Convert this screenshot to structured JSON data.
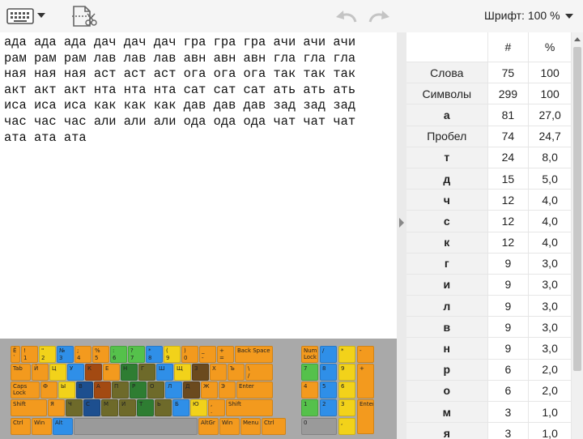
{
  "toolbar": {
    "font_label": "Шрифт: 100 %",
    "icons": [
      "keyboard-icon",
      "chevron-down-icon",
      "cut-file-icon",
      "undo-icon",
      "redo-icon"
    ]
  },
  "editor": {
    "lines": [
      "ада ада ада дач дач дач гра гра гра ачи ачи ачи",
      "рам рам рам лав лав лав авн авн авн гла гла гла",
      "ная ная ная аст аст аст ога ога ога так так так",
      "акт акт акт нта нта нта сат сат сат ать ать ать",
      "иса иса иса как как как дав дав дав зад зад зад",
      "час час час али али али ода ода ода чат чат чат",
      "ата ата ата"
    ]
  },
  "keyboard": {
    "rows": [
      [
        {
          "t": "Ё",
          "b": "`",
          "c": "orange"
        },
        {
          "t": "!",
          "b": "1",
          "c": "orange"
        },
        {
          "t": "\"",
          "b": "2",
          "c": "yellow"
        },
        {
          "t": "№",
          "b": "3",
          "c": "blue"
        },
        {
          "t": ";",
          "b": "4",
          "c": "orange"
        },
        {
          "t": "%",
          "b": "5",
          "c": "orange"
        },
        {
          "t": ":",
          "b": "6",
          "c": "green"
        },
        {
          "t": "?",
          "b": "7",
          "c": "green"
        },
        {
          "t": "*",
          "b": "8",
          "c": "blue"
        },
        {
          "t": "(",
          "b": "9",
          "c": "yellow"
        },
        {
          "t": ")",
          "b": "0",
          "c": "orange"
        },
        {
          "t": "_",
          "b": "-",
          "c": "orange"
        },
        {
          "t": "+",
          "b": "=",
          "c": "orange"
        },
        {
          "t": "Back Space",
          "b": "",
          "c": "orange"
        }
      ],
      [
        {
          "t": "Tab",
          "b": "",
          "c": "orange"
        },
        {
          "t": "Й",
          "b": "",
          "c": "orange"
        },
        {
          "t": "Ц",
          "b": "",
          "c": "yellow"
        },
        {
          "t": "У",
          "b": "",
          "c": "blue"
        },
        {
          "t": "К",
          "b": "",
          "c": "rust"
        },
        {
          "t": "Е",
          "b": "",
          "c": "orange"
        },
        {
          "t": "Н",
          "b": "",
          "c": "darkgreen"
        },
        {
          "t": "Г",
          "b": "",
          "c": "olive"
        },
        {
          "t": "Ш",
          "b": "",
          "c": "blue"
        },
        {
          "t": "Щ",
          "b": "",
          "c": "yellow"
        },
        {
          "t": "З",
          "b": "",
          "c": "brown"
        },
        {
          "t": "Х",
          "b": "",
          "c": "orange"
        },
        {
          "t": "Ъ",
          "b": "",
          "c": "orange"
        },
        {
          "t": "\\",
          "b": "/",
          "c": "orange"
        }
      ],
      [
        {
          "t": "Caps Lock",
          "b": "",
          "c": "orange"
        },
        {
          "t": "Ф",
          "b": "",
          "c": "orange"
        },
        {
          "t": "Ы",
          "b": "",
          "c": "yellow"
        },
        {
          "t": "В",
          "b": "",
          "c": "navy"
        },
        {
          "t": "А",
          "b": "",
          "c": "rust"
        },
        {
          "t": "П",
          "b": "",
          "c": "olive"
        },
        {
          "t": "Р",
          "b": "",
          "c": "darkgreen"
        },
        {
          "t": "О",
          "b": "",
          "c": "olive"
        },
        {
          "t": "Л",
          "b": "",
          "c": "blue"
        },
        {
          "t": "Д",
          "b": "",
          "c": "brown"
        },
        {
          "t": "Ж",
          "b": "",
          "c": "orange"
        },
        {
          "t": "Э",
          "b": "",
          "c": "orange"
        },
        {
          "t": "Enter",
          "b": "",
          "c": "orange"
        }
      ],
      [
        {
          "t": "Shift",
          "b": "",
          "c": "orange"
        },
        {
          "t": "Я",
          "b": "",
          "c": "orange"
        },
        {
          "t": "Ч",
          "b": "",
          "c": "olive"
        },
        {
          "t": "С",
          "b": "",
          "c": "navy"
        },
        {
          "t": "М",
          "b": "",
          "c": "olive"
        },
        {
          "t": "И",
          "b": "",
          "c": "olive"
        },
        {
          "t": "Т",
          "b": "",
          "c": "darkgreen"
        },
        {
          "t": "Ь",
          "b": "",
          "c": "olive"
        },
        {
          "t": "Б",
          "b": "",
          "c": "blue"
        },
        {
          "t": "Ю",
          "b": "",
          "c": "yellow"
        },
        {
          "t": ",",
          "b": ".",
          "c": "orange"
        },
        {
          "t": "Shift",
          "b": "",
          "c": "orange"
        }
      ],
      [
        {
          "t": "Ctrl",
          "b": "",
          "c": "orange"
        },
        {
          "t": "Win",
          "b": "",
          "c": "orange"
        },
        {
          "t": "Alt",
          "b": "",
          "c": "blue"
        },
        {
          "t": "",
          "b": "",
          "c": "gray"
        },
        {
          "t": "AltGr",
          "b": "",
          "c": "orange"
        },
        {
          "t": "Win",
          "b": "",
          "c": "orange"
        },
        {
          "t": "Menu",
          "b": "",
          "c": "orange"
        },
        {
          "t": "Ctrl",
          "b": "",
          "c": "orange"
        }
      ]
    ],
    "numpad": [
      {
        "t": "Num Lock",
        "b": "",
        "c": "orange"
      },
      {
        "t": "/",
        "b": "",
        "c": "blue"
      },
      {
        "t": "*",
        "b": "",
        "c": "yellow"
      },
      {
        "t": "-",
        "b": "",
        "c": "orange"
      },
      {
        "t": "7",
        "b": "",
        "c": "green"
      },
      {
        "t": "8",
        "b": "",
        "c": "blue"
      },
      {
        "t": "9",
        "b": "",
        "c": "yellow"
      },
      {
        "t": "+",
        "b": "",
        "c": "orange"
      },
      {
        "t": "4",
        "b": "",
        "c": "orange"
      },
      {
        "t": "5",
        "b": "",
        "c": "blue"
      },
      {
        "t": "6",
        "b": "",
        "c": "yellow"
      },
      {
        "t": "1",
        "b": "",
        "c": "green"
      },
      {
        "t": "2",
        "b": "",
        "c": "blue"
      },
      {
        "t": "3",
        "b": "",
        "c": "yellow"
      },
      {
        "t": "Enter",
        "b": "",
        "c": "orange"
      },
      {
        "t": "0",
        "b": "",
        "c": "gray"
      },
      {
        "t": ",",
        "b": "",
        "c": "yellow"
      }
    ],
    "colors": {
      "orange": "#f39a1e",
      "yellow": "#f2d21a",
      "blue": "#2f8fe8",
      "green": "#55c14b",
      "darkgreen": "#2e7d32",
      "olive": "#6e6a2a",
      "navy": "#1d4f8f",
      "rust": "#a34a12",
      "brown": "#6b4a1e",
      "gray": "#9a9a9a"
    }
  },
  "stats": {
    "headers": [
      "",
      "#",
      "%"
    ],
    "rows": [
      {
        "label": "Слова",
        "count": "75",
        "pct": "100",
        "bold": false
      },
      {
        "label": "Символы",
        "count": "299",
        "pct": "100",
        "bold": false
      },
      {
        "label": "а",
        "count": "81",
        "pct": "27,0",
        "bold": true
      },
      {
        "label": "Пробел",
        "count": "74",
        "pct": "24,7",
        "bold": false
      },
      {
        "label": "т",
        "count": "24",
        "pct": "8,0",
        "bold": true
      },
      {
        "label": "д",
        "count": "15",
        "pct": "5,0",
        "bold": true
      },
      {
        "label": "ч",
        "count": "12",
        "pct": "4,0",
        "bold": true
      },
      {
        "label": "с",
        "count": "12",
        "pct": "4,0",
        "bold": true
      },
      {
        "label": "к",
        "count": "12",
        "pct": "4,0",
        "bold": true
      },
      {
        "label": "г",
        "count": "9",
        "pct": "3,0",
        "bold": true
      },
      {
        "label": "и",
        "count": "9",
        "pct": "3,0",
        "bold": true
      },
      {
        "label": "л",
        "count": "9",
        "pct": "3,0",
        "bold": true
      },
      {
        "label": "в",
        "count": "9",
        "pct": "3,0",
        "bold": true
      },
      {
        "label": "н",
        "count": "9",
        "pct": "3,0",
        "bold": true
      },
      {
        "label": "р",
        "count": "6",
        "pct": "2,0",
        "bold": true
      },
      {
        "label": "о",
        "count": "6",
        "pct": "2,0",
        "bold": true
      },
      {
        "label": "м",
        "count": "3",
        "pct": "1,0",
        "bold": true
      },
      {
        "label": "я",
        "count": "3",
        "pct": "1,0",
        "bold": true
      }
    ]
  }
}
